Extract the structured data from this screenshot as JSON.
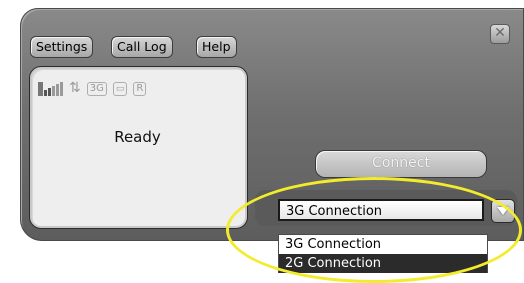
{
  "window": {
    "close_icon": "close-icon",
    "menu": [
      "Settings",
      "Call Log",
      "Help"
    ]
  },
  "status": {
    "text": "Ready",
    "indicators": {
      "signal_icon": "signal-bars-icon",
      "signal_bars_active": 2,
      "signal_bars_total": 5,
      "data_icon": "up-down-arrows-icon",
      "network_label": "3G",
      "roaming_label": "R",
      "card_icon": "sim-card-icon"
    }
  },
  "connect": {
    "label": "Connect"
  },
  "connection_select": {
    "selected": "3G Connection",
    "options": [
      "3G Connection",
      "2G Connection"
    ],
    "highlighted_option": "2G Connection"
  },
  "colors": {
    "panel": "#6f6f6f",
    "annotation_highlight": "#f2ec2c",
    "selected_option": "#2b2b2b"
  }
}
